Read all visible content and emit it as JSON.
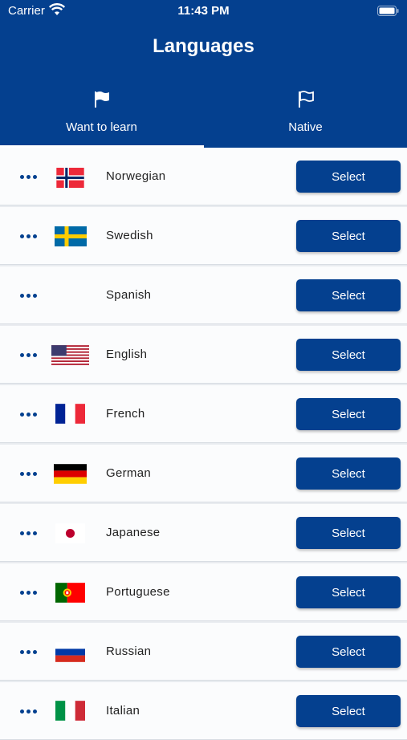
{
  "status": {
    "carrier": "Carrier",
    "time": "11:43 PM"
  },
  "header": {
    "title": "Languages"
  },
  "tabs": [
    {
      "label": "Want to learn",
      "icon": "flag-filled-icon",
      "active": true
    },
    {
      "label": "Native",
      "icon": "flag-outline-icon",
      "active": false
    }
  ],
  "languages": [
    {
      "name": "Norwegian",
      "flag": "norway-flag-icon",
      "button": "Select"
    },
    {
      "name": "Swedish",
      "flag": "sweden-flag-icon",
      "button": "Select"
    },
    {
      "name": "Spanish",
      "flag": "",
      "button": "Select"
    },
    {
      "name": "English",
      "flag": "usa-flag-icon",
      "button": "Select"
    },
    {
      "name": "French",
      "flag": "france-flag-icon",
      "button": "Select"
    },
    {
      "name": "German",
      "flag": "germany-flag-icon",
      "button": "Select"
    },
    {
      "name": "Japanese",
      "flag": "japan-flag-icon",
      "button": "Select"
    },
    {
      "name": "Portuguese",
      "flag": "portugal-flag-icon",
      "button": "Select"
    },
    {
      "name": "Russian",
      "flag": "russia-flag-icon",
      "button": "Select"
    },
    {
      "name": "Italian",
      "flag": "italy-flag-icon",
      "button": "Select"
    }
  ],
  "colors": {
    "primary": "#04408f",
    "background": "#fbfcfd"
  }
}
